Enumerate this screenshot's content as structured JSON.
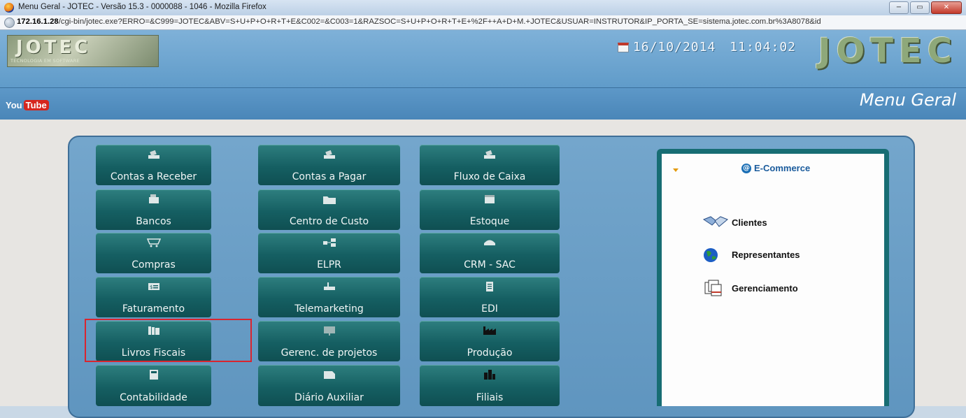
{
  "window": {
    "title": "Menu Geral - JOTEC - Versão 15.3 - 0000088 - 1046 - Mozilla Firefox",
    "buttons": [
      "−",
      "▭",
      "✕"
    ]
  },
  "address": {
    "host": "172.16.1.28",
    "path": "/cgi-bin/jotec.exe?ERRO=&C999=JOTEC&ABV=S+U+P+O+R+T+E&C002=&C003=1&RAZSOC=S+U+P+O+R+T+E+%2F++A+D+M.+JOTEC&USUAR=INSTRUTOR&IP_PORTA_SE=sistema.jotec.com.br%3A8078&id"
  },
  "header": {
    "logo_text": "JOTEC",
    "logo_subtext": "TECNOLOGIA EM SOFTWARE",
    "date": "16/10/2014",
    "time": "11:04:02",
    "brand": "JOTEC"
  },
  "subbar": {
    "youtube_you": "You",
    "youtube_tube": "Tube",
    "page_title": "Menu Geral"
  },
  "tiles": [
    {
      "label": "Contas a Receber",
      "icon": "printer-tray-icon"
    },
    {
      "label": "Contas a Pagar",
      "icon": "printer-tray-icon"
    },
    {
      "label": "Fluxo de Caixa",
      "icon": "printer-tray-icon"
    },
    {
      "label": "Bancos",
      "icon": "cash-register-icon"
    },
    {
      "label": "Centro de Custo",
      "icon": "folder-icon"
    },
    {
      "label": "Estoque",
      "icon": "box-icon"
    },
    {
      "label": "Compras",
      "icon": "shopping-cart-icon"
    },
    {
      "label": "ELPR",
      "icon": "network-icon"
    },
    {
      "label": "CRM - SAC",
      "icon": "telephone-icon"
    },
    {
      "label": "Faturamento",
      "icon": "invoice-icon"
    },
    {
      "label": "Telemarketing",
      "icon": "phone-tray-icon"
    },
    {
      "label": "EDI",
      "icon": "document-icon"
    },
    {
      "label": "Livros Fiscais",
      "icon": "books-icon"
    },
    {
      "label": "Gerenc. de projetos",
      "icon": "projects-icon"
    },
    {
      "label": "Produção",
      "icon": "factory-icon"
    },
    {
      "label": "Contabilidade",
      "icon": "calculator-icon"
    },
    {
      "label": "Diário Auxiliar",
      "icon": "journal-icon"
    },
    {
      "label": "Filiais",
      "icon": "buildings-icon"
    }
  ],
  "ecommerce": {
    "title": "E-Commerce",
    "items": [
      {
        "label": "Clientes",
        "icon": "handshake-icon"
      },
      {
        "label": "Representantes",
        "icon": "globe-icon"
      },
      {
        "label": "Gerenciamento",
        "icon": "pages-icon"
      }
    ]
  },
  "colors": {
    "tile": "#155f62",
    "highlight": "#d9252f",
    "panel": "#5f95bf",
    "header": "#6fa6d0"
  }
}
